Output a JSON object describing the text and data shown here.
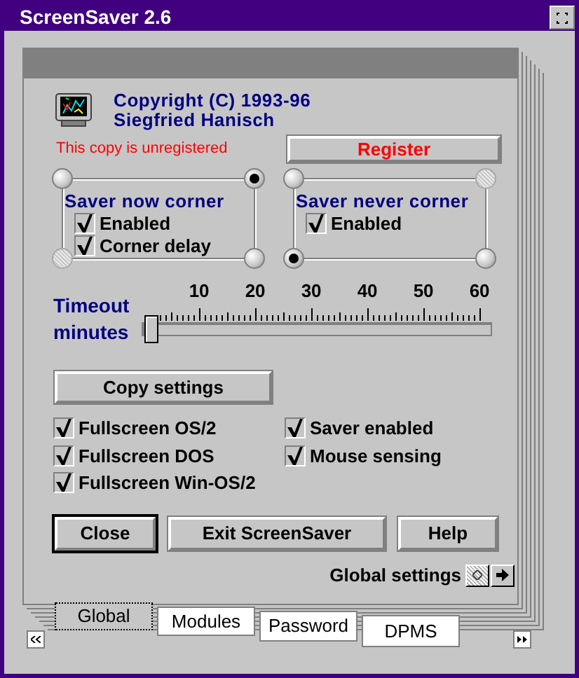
{
  "window": {
    "title": "ScreenSaver 2.6"
  },
  "about": {
    "copyright": "Copyright (C) 1993-96",
    "author": "Siegfried Hanisch",
    "notice": "This copy is unregistered",
    "register_button": "Register"
  },
  "corner_groups": [
    {
      "title": "Saver now corner",
      "corners": [
        {
          "selected": false,
          "disabled": false
        },
        {
          "selected": true,
          "disabled": false
        },
        {
          "selected": false,
          "disabled": true
        },
        {
          "selected": false,
          "disabled": false
        }
      ],
      "options": [
        {
          "label": "Enabled",
          "checked": true
        },
        {
          "label": "Corner delay",
          "checked": true
        }
      ]
    },
    {
      "title": "Saver never corner",
      "corners": [
        {
          "selected": false,
          "disabled": false
        },
        {
          "selected": false,
          "disabled": true
        },
        {
          "selected": true,
          "disabled": false
        },
        {
          "selected": false,
          "disabled": false
        }
      ],
      "options": [
        {
          "label": "Enabled",
          "checked": true
        }
      ]
    }
  ],
  "timeout": {
    "label": "Timeout minutes",
    "ticks": [
      "10",
      "20",
      "30",
      "40",
      "50",
      "60"
    ],
    "level": 0
  },
  "copy_button": "Copy settings",
  "left_options": [
    {
      "label": "Fullscreen OS/2",
      "checked": true
    },
    {
      "label": "Fullscreen DOS",
      "checked": true
    },
    {
      "label": "Fullscreen Win-OS/2",
      "checked": true
    }
  ],
  "right_options": [
    {
      "label": "Saver enabled",
      "checked": true
    },
    {
      "label": "Mouse sensing",
      "checked": true
    }
  ],
  "buttons": [
    {
      "label": "Close",
      "default": true
    },
    {
      "label": "Exit ScreenSaver",
      "default": false
    },
    {
      "label": "Help",
      "default": false
    }
  ],
  "page": {
    "title": "Global settings",
    "back_disabled": true,
    "forward_disabled": false
  },
  "tabs": [
    {
      "label": "Global",
      "selected": true
    },
    {
      "label": "Modules",
      "selected": false
    },
    {
      "label": "Password",
      "selected": false
    },
    {
      "label": "DPMS",
      "selected": false
    }
  ]
}
